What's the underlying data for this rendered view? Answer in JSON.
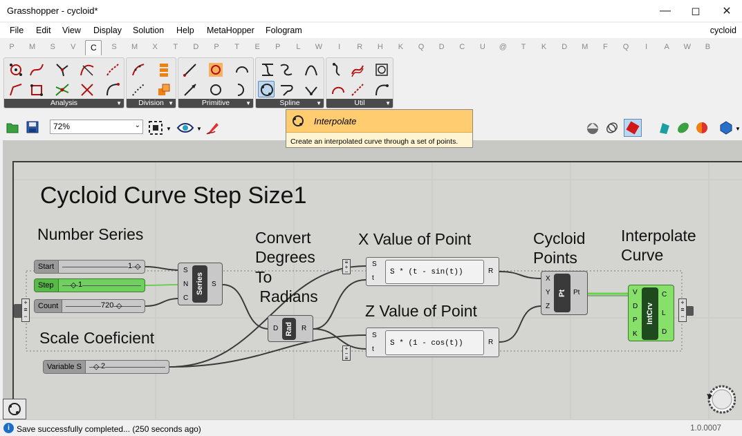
{
  "window": {
    "title": "Grasshopper - cycloid*",
    "minimize_icon": "minimize-icon",
    "maximize_icon": "maximize-icon",
    "close_icon": "close-icon"
  },
  "menu": {
    "items": [
      "File",
      "Edit",
      "View",
      "Display",
      "Solution",
      "Help",
      "MetaHopper",
      "Fologram"
    ],
    "document_name": "cycloid"
  },
  "tabs": [
    "P",
    "M",
    "S",
    "V",
    "C",
    "S",
    "M",
    "X",
    "T",
    "D",
    "P",
    "T",
    "E",
    "P",
    "L",
    "W",
    "I",
    "R",
    "H",
    "K",
    "Q",
    "D",
    "C",
    "U",
    "@",
    "T",
    "K",
    "D",
    "M",
    "F",
    "Q",
    "I",
    "A",
    "W",
    "B"
  ],
  "active_tab": "C",
  "ribbon": {
    "groups": [
      {
        "label": "Analysis"
      },
      {
        "label": "Division"
      },
      {
        "label": "Primitive"
      },
      {
        "label": "Spline"
      },
      {
        "label": "Util"
      }
    ]
  },
  "toolbar": {
    "zoom": "72%"
  },
  "tooltip": {
    "title": "Interpolate",
    "description": "Create an interpolated curve through a set of points."
  },
  "canvas": {
    "main_title": "Cycloid Curve Step Size1",
    "labels": {
      "number_series": "Number Series",
      "convert_1": "Convert",
      "convert_2": "Degrees",
      "convert_3": "To",
      "convert_4": " Radians",
      "x_value": "X Value of Point",
      "z_value": "Z Value of Point",
      "cycloid_1": "Cycloid",
      "cycloid_2": "Points",
      "interp_1": "Interpolate",
      "interp_2": "Curve",
      "scale": "Scale Coeficient"
    },
    "sliders": {
      "start": {
        "name": "Start",
        "value": "1"
      },
      "step": {
        "name": "Step",
        "value": "1"
      },
      "count": {
        "name": "Count",
        "value": "720"
      },
      "variable_s": {
        "name": "Variable S",
        "value": "2"
      }
    },
    "series_node": {
      "name": "Series",
      "inputs": [
        "S",
        "N",
        "C"
      ],
      "output": "S"
    },
    "rad_node": {
      "name": "Rad",
      "input": "D",
      "output": "R"
    },
    "expr_x": {
      "inputs": [
        "S",
        "t"
      ],
      "expression": "S * (t - sin(t))",
      "output": "R"
    },
    "expr_z": {
      "inputs": [
        "S",
        "t"
      ],
      "expression": "S * (1 - cos(t))",
      "output": "R"
    },
    "pt_node": {
      "name": "Pt",
      "inputs": [
        "X",
        "Y",
        "Z"
      ],
      "output": "Pt"
    },
    "intcrv_node": {
      "name": "IntCrv",
      "inputs": [
        "V",
        "D",
        "P",
        "K"
      ],
      "outputs": [
        "C",
        "L",
        "D"
      ]
    }
  },
  "status": {
    "message": "Save successfully completed... (250 seconds ago)",
    "version": "1.0.0007"
  },
  "colors": {
    "canvas_bg": "#d4d4d0",
    "slider_green": "#6fd060",
    "tooltip_bg": "#ffcc70",
    "wire": "#3a3a3a",
    "wire_green": "#6ad050"
  }
}
